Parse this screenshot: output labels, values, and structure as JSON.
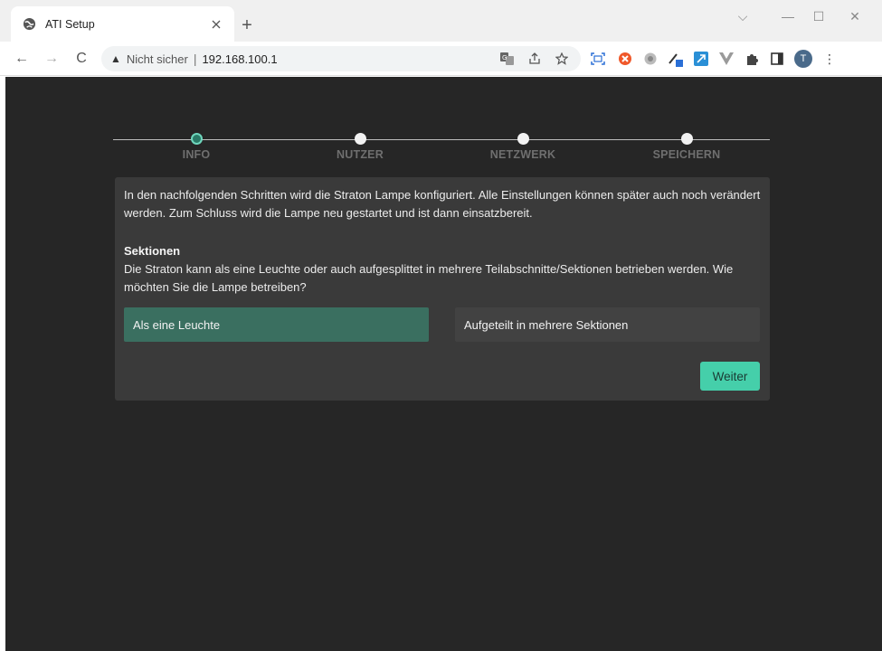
{
  "browser": {
    "tab_title": "ATI Setup",
    "new_tab_label": "+",
    "window_controls": {
      "minimize": "—",
      "maximize": "☐",
      "close": "✕",
      "dropdown": "⌵"
    },
    "nav": {
      "back": "←",
      "forward": "→",
      "reload": "C"
    },
    "omnibox": {
      "warning_glyph": "▲",
      "security_text": "Nicht sicher",
      "separator": "|",
      "url": "192.168.100.1"
    },
    "profile_initial": "T",
    "extension_icons": [
      "translate-icon",
      "share-icon",
      "star-icon",
      "screenshot-icon",
      "ublock-icon",
      "globe-icon",
      "pen-icon",
      "expand-icon",
      "vue-icon",
      "puzzle-icon",
      "sidepanel-icon",
      "menu-icon"
    ]
  },
  "wizard": {
    "steps": [
      {
        "label": "INFO",
        "active": true
      },
      {
        "label": "NUTZER",
        "active": false
      },
      {
        "label": "NETZWERK",
        "active": false
      },
      {
        "label": "SPEICHERN",
        "active": false
      }
    ],
    "intro": "In den nachfolgenden Schritten wird die Straton Lampe konfiguriert. Alle Einstellungen können später auch noch verändert werden. Zum Schluss wird die Lampe neu gestartet und ist dann einsatzbereit.",
    "section_heading": "Sektionen",
    "section_text": "Die Straton kann als eine Leuchte oder auch aufgesplittet in mehrere Teilabschnitte/Sektionen betrieben werden. Wie möchten Sie die Lampe betreiben?",
    "options": [
      {
        "label": "Als eine Leuchte",
        "selected": true
      },
      {
        "label": "Aufgeteilt in mehrere Sektionen",
        "selected": false
      }
    ],
    "next_button": "Weiter"
  },
  "colors": {
    "page_bg": "#262626",
    "card_bg": "#3a3a3a",
    "accent": "#45cfaa",
    "selected_option": "#3a6f60"
  }
}
